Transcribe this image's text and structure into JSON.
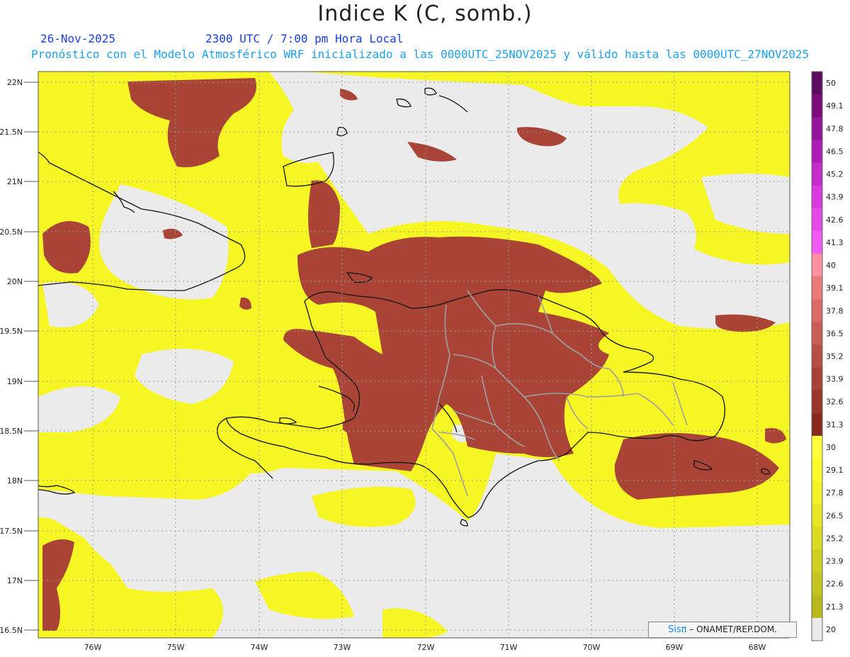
{
  "title": "Indice K (C, somb.)",
  "date": "26-Nov-2025",
  "time": "2300 UTC / 7:00 pm Hora Local",
  "subtitle": "Pronóstico con el Modelo Atmosférico WRF inicializado a las 0000UTC_25NOV2025 y válido hasta las  0000UTC_27NOV2025",
  "lat_labels": [
    "22N",
    "21.5N",
    "21N",
    "20.5N",
    "20N",
    "19.5N",
    "19N",
    "18.5N",
    "18N",
    "17.5N",
    "17N",
    "16.5N"
  ],
  "lon_labels": [
    "76W",
    "75W",
    "74W",
    "73W",
    "72W",
    "71W",
    "70W",
    "69W",
    "68W"
  ],
  "colorbar": {
    "levels": [
      "50",
      "49.1",
      "47.8",
      "46.5",
      "45.2",
      "43.9",
      "42.6",
      "41.3",
      "40",
      "39.1",
      "37.8",
      "36.5",
      "35.2",
      "33.9",
      "32.6",
      "31.3",
      "30",
      "29.1",
      "27.8",
      "26.5",
      "25.2",
      "23.9",
      "22.6",
      "21.3",
      "20"
    ],
    "colors": [
      "#5e0a5e",
      "#7b0a7b",
      "#96149b",
      "#ad1cb4",
      "#c32ccb",
      "#d83adf",
      "#e54ae9",
      "#f05cf2",
      "#ff90a0",
      "#ea7a7a",
      "#d96a66",
      "#c95c56",
      "#b84e47",
      "#a84239",
      "#98362b",
      "#882a1e",
      "#ffff3a",
      "#fbfb2c",
      "#f2f226",
      "#e6e624",
      "#dada22",
      "#cfcf20",
      "#c4c41e",
      "#b9b91c",
      "#ebebeb"
    ]
  },
  "legend_levels_fill_meaning": {
    "low": "#ebebeb",
    "moderate": "#f6f624",
    "high": "#a94437"
  },
  "credit": {
    "brand": "Sisπ",
    "text": "– ONAMET/REP.DOM."
  }
}
